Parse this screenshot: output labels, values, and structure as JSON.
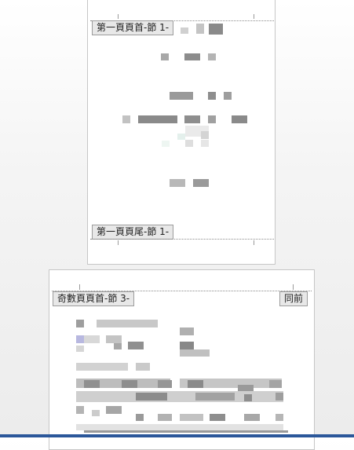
{
  "page1": {
    "header_tab": "第一頁頁首-節 1-",
    "footer_tab": "第一頁頁尾-節 1-"
  },
  "page2": {
    "header_tab": "奇數頁頁首-節 3-",
    "same_as_previous_tab": "同前"
  },
  "colors": {
    "ribbon_accent": "#2b579a",
    "tab_background": "#e8e8e8",
    "page_border": "#c6c6c6"
  }
}
